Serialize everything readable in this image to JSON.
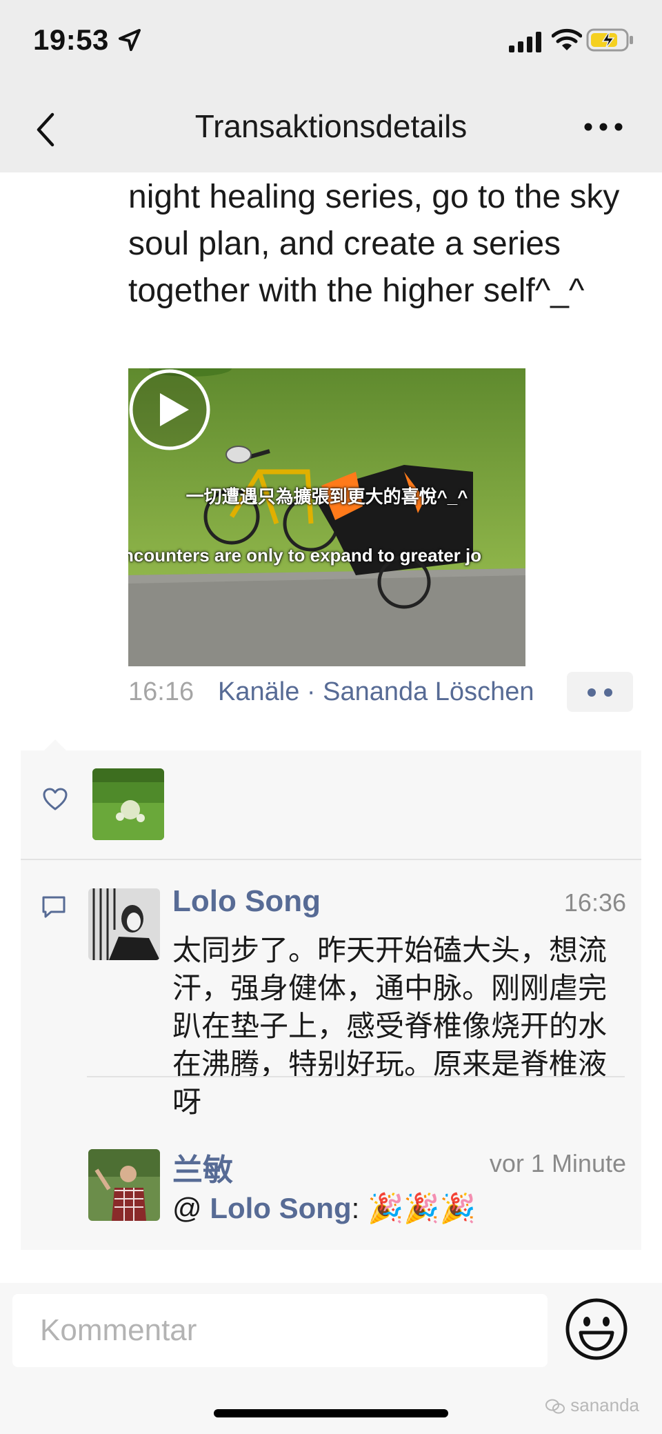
{
  "status_bar": {
    "time": "19:53"
  },
  "nav": {
    "title": "Transaktionsdetails",
    "back_icon": "chevron-left-icon",
    "more_icon": "ellipsis-icon"
  },
  "post": {
    "text": "night healing series, go to the sky soul plan, and create a series together with the higher self^_^",
    "video": {
      "caption_cn": "一切遭遇只為擴張到更大的喜悅^_^",
      "caption_en": "ncounters are only to expand to greater jo"
    },
    "time": "16:16",
    "source": "Kanäle · Sananda Löschen"
  },
  "social": {
    "like_icon": "heart-icon",
    "comment_icon": "comment-icon",
    "comments": [
      {
        "name": "Lolo Song",
        "time": "16:36",
        "text": "太同步了。昨天开始磕大头，想流汗，强身健体，通中脉。刚刚虐完趴在垫子上，感受脊椎像烧开的水在沸腾，特别好玩。原来是脊椎液呀"
      },
      {
        "name": "兰敏",
        "time": "vor 1 Minute",
        "reply_prefix": "@ ",
        "reply_to": "Lolo Song",
        "reply_suffix": ": 🎉🎉🎉"
      }
    ]
  },
  "input": {
    "placeholder": "Kommentar",
    "emoji_icon": "smiley-face-icon"
  },
  "watermark": "sananda",
  "colors": {
    "link": "#576b95",
    "bar_bg": "#ededed",
    "panel_bg": "#f7f7f7",
    "battery": "#f5d020"
  }
}
